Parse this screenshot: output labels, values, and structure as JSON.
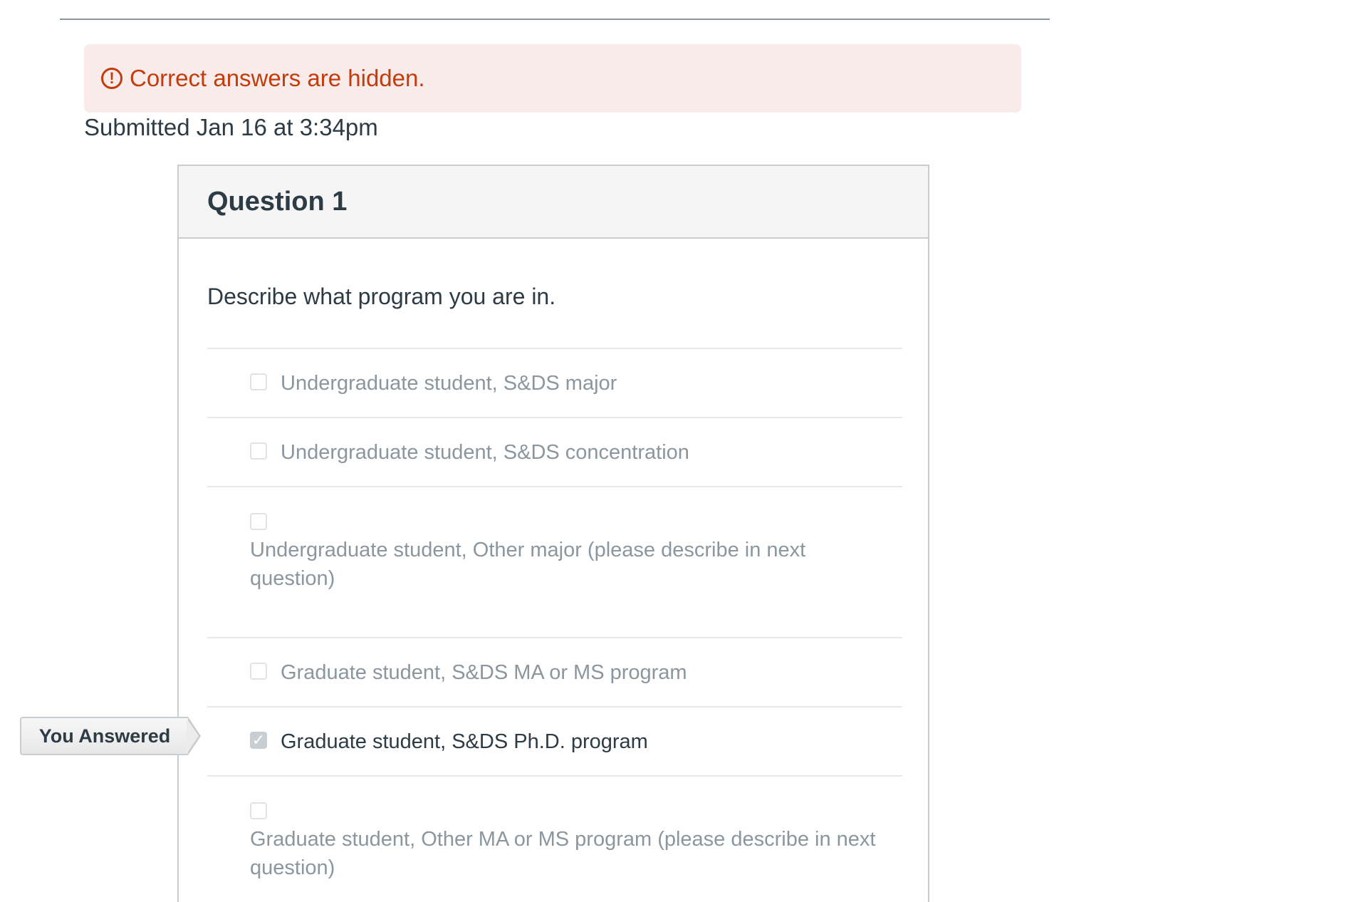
{
  "alert": {
    "icon": "exclamation-circle-icon",
    "text": "Correct answers are hidden.",
    "color": "#c23c0d",
    "background": "#f8ebea"
  },
  "submitted": "Submitted Jan 16 at 3:34pm",
  "question": {
    "title": "Question 1",
    "text": "Describe what program you are in.",
    "answers": [
      {
        "label": "Undergraduate student, S&DS major",
        "checked": false
      },
      {
        "label": "Undergraduate student, S&DS concentration",
        "checked": false
      },
      {
        "label": "Undergraduate student, Other major (please describe in next question)",
        "checked": false
      },
      {
        "label": "Graduate student, S&DS MA or MS program",
        "checked": false
      },
      {
        "label": "Graduate student, S&DS Ph.D. program",
        "checked": true
      },
      {
        "label": "Graduate student, Other MA or MS program (please describe in next question)",
        "checked": false
      }
    ]
  },
  "you_answered_label": "You Answered"
}
